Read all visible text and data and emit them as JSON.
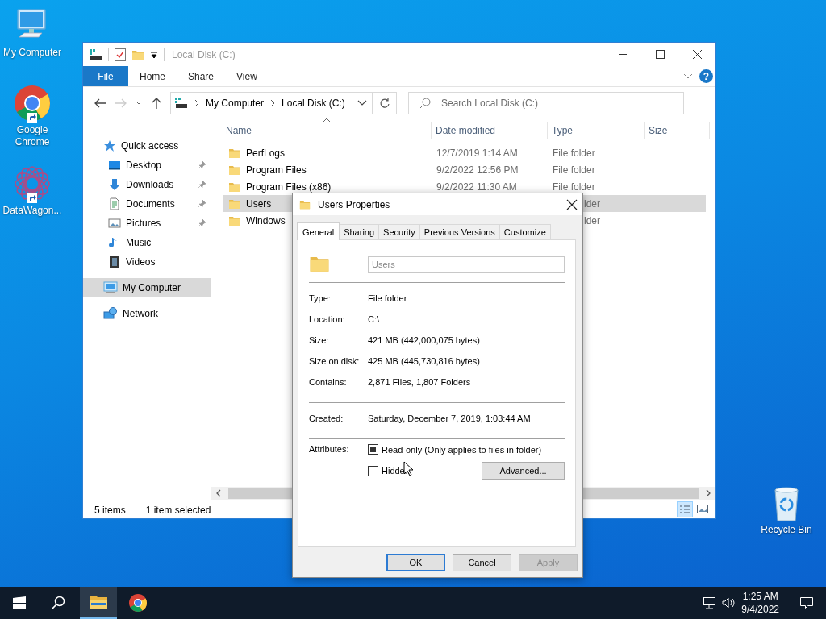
{
  "desktop_icons": [
    {
      "label": "My Computer",
      "kind": "computer"
    },
    {
      "label": "Google Chrome",
      "kind": "chrome"
    },
    {
      "label": "DataWagon...",
      "kind": "pattern"
    },
    {
      "label": "Recycle Bin",
      "kind": "recycle"
    }
  ],
  "explorer": {
    "title": "Local Disk (C:)",
    "ribbon_tabs": [
      {
        "label": "File",
        "kind": "menu"
      },
      {
        "label": "Home",
        "kind": "tab"
      },
      {
        "label": "Share",
        "kind": "tab"
      },
      {
        "label": "View",
        "kind": "tab"
      }
    ],
    "help_button": "?",
    "breadcrumb": [
      "My Computer",
      "Local Disk (C:)"
    ],
    "search": {
      "placeholder": "Search Local Disk (C:)"
    },
    "nav_pane": [
      {
        "label": "Quick access",
        "kind": "quick-access",
        "selected": false,
        "children": [
          {
            "label": "Desktop",
            "kind": "desktop",
            "pinned": true,
            "selected": false
          },
          {
            "label": "Downloads",
            "kind": "downloads",
            "pinned": true,
            "selected": false
          },
          {
            "label": "Documents",
            "kind": "documents",
            "pinned": true,
            "selected": false
          },
          {
            "label": "Pictures",
            "kind": "pictures",
            "pinned": true,
            "selected": false
          },
          {
            "label": "Music",
            "kind": "music",
            "pinned": false,
            "selected": false
          },
          {
            "label": "Videos",
            "kind": "videos",
            "pinned": false,
            "selected": false
          }
        ]
      },
      {
        "label": "My Computer",
        "kind": "computer",
        "selected": true
      },
      {
        "label": "Network",
        "kind": "network",
        "selected": false
      }
    ],
    "columns": [
      "Name",
      "Date modified",
      "Type",
      "Size"
    ],
    "files": [
      {
        "name": "PerfLogs",
        "date_modified": "12/7/2019 1:14 AM",
        "type": "File folder",
        "selected": false
      },
      {
        "name": "Program Files",
        "date_modified": "9/2/2022 12:56 PM",
        "type": "File folder",
        "selected": false
      },
      {
        "name": "Program Files (x86)",
        "date_modified": "9/2/2022 11:30 AM",
        "type": "File folder",
        "selected": false
      },
      {
        "name": "Users",
        "type": "lder",
        "selected": true
      },
      {
        "name": "Windows",
        "type": "lder",
        "selected": false
      }
    ],
    "status": {
      "item_count": "5 items",
      "selection": "1 item selected"
    }
  },
  "dialog": {
    "title": "Users Properties",
    "tabs": [
      {
        "label": "General",
        "selected": true
      },
      {
        "label": "Sharing",
        "selected": false
      },
      {
        "label": "Security",
        "selected": false
      },
      {
        "label": "Previous Versions",
        "selected": false
      },
      {
        "label": "Customize",
        "selected": false
      }
    ],
    "name_field": {
      "value": "Users"
    },
    "sections": [
      {
        "rows": [
          {
            "label": "Type:",
            "value": "File folder"
          },
          {
            "label": "Location:",
            "value": "C:\\"
          },
          {
            "label": "Size:",
            "value": "421 MB (442,000,075 bytes)"
          },
          {
            "label": "Size on disk:",
            "value": "425 MB (445,730,816 bytes)"
          },
          {
            "label": "Contains:",
            "value": "2,871 Files, 1,807 Folders"
          }
        ]
      },
      {
        "rows": [
          {
            "label": "Created:",
            "value": "Saturday, December 7, 2019, 1:03:44 AM"
          }
        ]
      }
    ],
    "attributes": {
      "label": "Attributes:",
      "options": [
        {
          "label": "Read-only (Only applies to files in folder)",
          "checked": true,
          "indeterminate": true
        },
        {
          "label": "Hidden",
          "checked": false,
          "indeterminate": false
        }
      ],
      "advanced_button": "Advanced..."
    },
    "buttons": [
      {
        "label": "OK",
        "default": true,
        "disabled": false
      },
      {
        "label": "Cancel",
        "default": false,
        "disabled": false
      },
      {
        "label": "Apply",
        "default": false,
        "disabled": true
      }
    ]
  },
  "taskbar": {
    "apps": [
      {
        "kind": "file-explorer",
        "active": true
      },
      {
        "kind": "chrome",
        "active": false
      }
    ],
    "time": "1:25 AM",
    "date": "9/4/2022"
  }
}
